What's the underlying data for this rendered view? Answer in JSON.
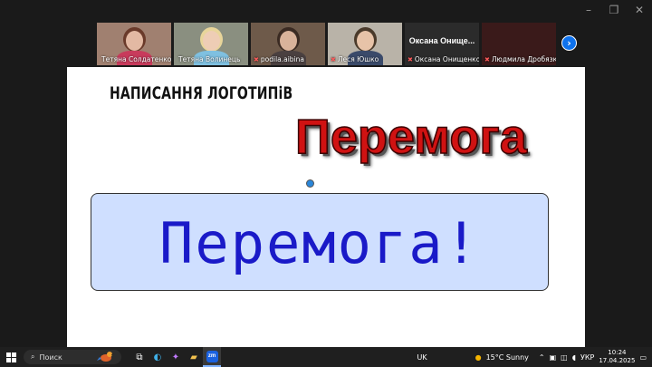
{
  "participants": [
    {
      "name": "Тетяна Солдатенко",
      "muted": false,
      "active": false,
      "bg": "#a08070",
      "skin": "#e3b9a3",
      "shirt": "#c83b5c",
      "hair": "#6a3a2a"
    },
    {
      "name": "Тетяна Волинець",
      "muted": false,
      "active": true,
      "bg": "#8a8f80",
      "skin": "#eecdb5",
      "shirt": "#7fc0e0",
      "hair": "#e8d59a"
    },
    {
      "name": "podila.aibina",
      "muted": true,
      "active": false,
      "bg": "#6e5a4a",
      "skin": "#d8b29a",
      "shirt": "#4a4040",
      "hair": "#3a2a22"
    },
    {
      "name": "Леся Юшко",
      "muted": true,
      "active": false,
      "bg": "#b9b3a8",
      "skin": "#e7c3a8",
      "shirt": "#3a4a6a",
      "hair": "#4a3a2a"
    },
    {
      "name": "Оксана Онищенко",
      "muted": true,
      "active": false,
      "big": "Оксана Онище..."
    },
    {
      "name": "Людмила Дробязко",
      "muted": true,
      "active": false,
      "bg": "#3a1a1a"
    }
  ],
  "slide": {
    "heading": "НАПИСАННЯ ЛОГОТИПіВ",
    "logo_red": "Перемога",
    "logo_blue": "Перемога!"
  },
  "taskbar": {
    "search_placeholder": "Поиск",
    "layout_indicator": "UK",
    "weather": "15°C  Sunny",
    "lang": "УКР",
    "time": "10:24",
    "date": "17.04.2025"
  }
}
